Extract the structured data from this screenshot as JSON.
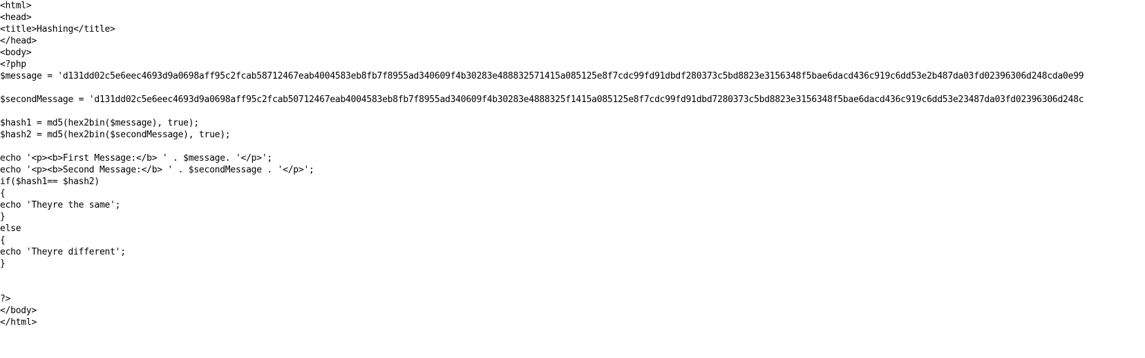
{
  "document": {
    "lines": [
      "<html>",
      "<head>",
      "<title>Hashing</title>",
      "</head>",
      "<body>",
      "<?php",
      "$message = 'd131dd02c5e6eec4693d9a0698aff95c2fcab58712467eab4004583eb8fb7f8955ad340609f4b30283e488832571415a085125e8f7cdc99fd91dbdf280373c5bd8823e3156348f5bae6dacd436c919c6dd53e2b487da03fd02396306d248cda0e99",
      "",
      "$secondMessage = 'd131dd02c5e6eec4693d9a0698aff95c2fcab50712467eab4004583eb8fb7f8955ad340609f4b30283e4888325f1415a085125e8f7cdc99fd91dbd7280373c5bd8823e3156348f5bae6dacd436c919c6dd53e23487da03fd02396306d248c",
      "",
      "$hash1 = md5(hex2bin($message), true);",
      "$hash2 = md5(hex2bin($secondMessage), true);",
      "",
      "echo '<p><b>First Message:</b> ' . $message. '</p>';",
      "echo '<p><b>Second Message:</b> ' . $secondMessage . '</p>';",
      "if($hash1== $hash2)",
      "{",
      "echo 'Theyre the same';",
      "}",
      "else",
      "{",
      "echo 'Theyre different';",
      "}",
      "",
      "",
      "?>",
      "</body>",
      "</html>"
    ]
  }
}
